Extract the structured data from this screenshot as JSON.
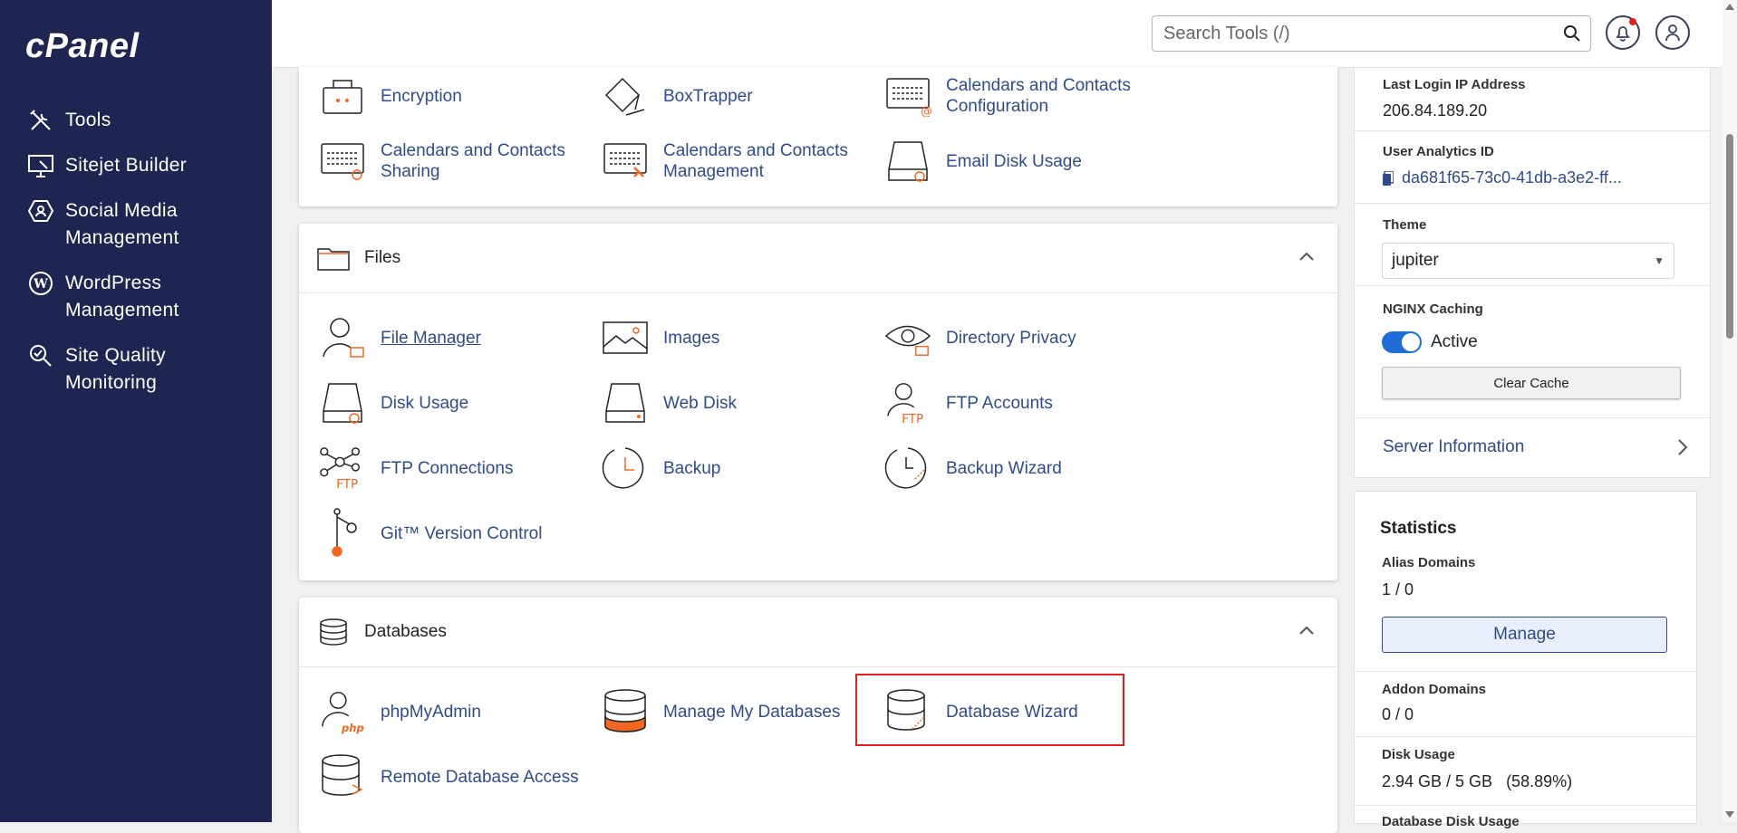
{
  "app": {
    "logo_text": "cPanel"
  },
  "sidebar": {
    "items": [
      {
        "label": "Tools",
        "icon": "tools-icon"
      },
      {
        "label": "Sitejet Builder",
        "icon": "monitor-icon"
      },
      {
        "label": "Social Media Management",
        "icon": "social-icon"
      },
      {
        "label": "WordPress Management",
        "icon": "wordpress-icon"
      },
      {
        "label": "Site Quality Monitoring",
        "icon": "magnifier-icon"
      }
    ]
  },
  "header": {
    "search_placeholder": "Search Tools (/)"
  },
  "email_section": {
    "tools": [
      {
        "label": "Encryption",
        "icon": "encryption-icon"
      },
      {
        "label": "BoxTrapper",
        "icon": "boxtrapper-icon"
      },
      {
        "label": "Calendars and Contacts Configuration",
        "icon": "calendar-config-icon"
      },
      {
        "label": "Calendars and Contacts Sharing",
        "icon": "calendar-sharing-icon"
      },
      {
        "label": "Calendars and Contacts Management",
        "icon": "calendar-management-icon"
      },
      {
        "label": "Email Disk Usage",
        "icon": "email-disk-icon"
      }
    ]
  },
  "files_section": {
    "title": "Files",
    "tools": [
      {
        "label": "File Manager",
        "icon": "file-manager-icon"
      },
      {
        "label": "Images",
        "icon": "images-icon"
      },
      {
        "label": "Directory Privacy",
        "icon": "directory-privacy-icon"
      },
      {
        "label": "Disk Usage",
        "icon": "disk-usage-icon"
      },
      {
        "label": "Web Disk",
        "icon": "web-disk-icon"
      },
      {
        "label": "FTP Accounts",
        "icon": "ftp-accounts-icon"
      },
      {
        "label": "FTP Connections",
        "icon": "ftp-connections-icon"
      },
      {
        "label": "Backup",
        "icon": "backup-icon"
      },
      {
        "label": "Backup Wizard",
        "icon": "backup-wizard-icon"
      },
      {
        "label": "Git™ Version Control",
        "icon": "git-icon"
      }
    ]
  },
  "databases_section": {
    "title": "Databases",
    "tools": [
      {
        "label": "phpMyAdmin",
        "icon": "phpmyadmin-icon"
      },
      {
        "label": "Manage My Databases",
        "icon": "manage-databases-icon"
      },
      {
        "label": "Database Wizard",
        "icon": "database-wizard-icon"
      },
      {
        "label": "Remote Database Access",
        "icon": "remote-database-icon"
      }
    ]
  },
  "info": {
    "last_login_label": "Last Login IP Address",
    "last_login_value": "206.84.189.20",
    "analytics_label": "User Analytics ID",
    "analytics_value": "da681f65-73c0-41db-a3e2-ff...",
    "theme_label": "Theme",
    "theme_value": "jupiter",
    "nginx_label": "NGINX Caching",
    "nginx_status": "Active",
    "clear_cache": "Clear Cache",
    "server_info": "Server Information"
  },
  "stats": {
    "title": "Statistics",
    "alias_label": "Alias Domains",
    "alias_value": "1 / 0",
    "manage": "Manage",
    "addon_label": "Addon Domains",
    "addon_value": "0 / 0",
    "disk_label": "Disk Usage",
    "disk_value": "2.94 GB / 5 GB   (58.89%)",
    "db_disk_label": "Database Disk Usage"
  },
  "colors": {
    "sidebar": "#1e2551",
    "link": "#2f4b8c",
    "accent": "#f26722",
    "highlight": "#e02020"
  }
}
